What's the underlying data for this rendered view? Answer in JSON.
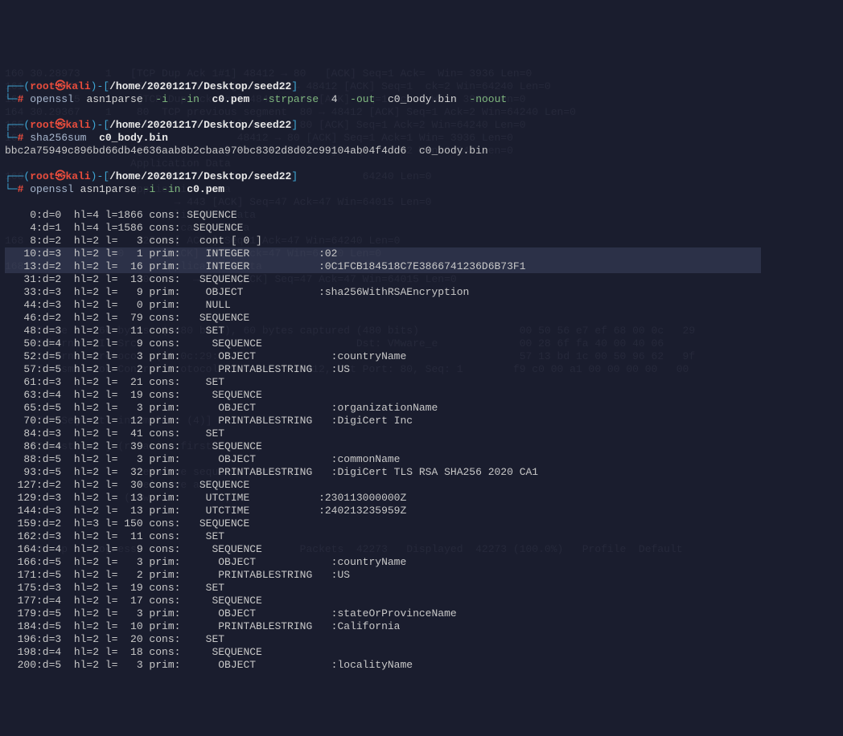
{
  "prompts": [
    {
      "open": "┌──(",
      "user": "root",
      "glyph": "㉿",
      "host": "kali",
      "mid": ")-[",
      "path": "/home/20201217/Desktop/seed22",
      "close": "]",
      "hash": "└─#",
      "command_parts": [
        {
          "t": "openssl",
          "c": "cmd"
        },
        {
          "t": "  asn1parse  ",
          "c": "arg"
        },
        {
          "t": "-i",
          "c": "gr"
        },
        {
          "t": "  ",
          "c": "arg"
        },
        {
          "t": "-in",
          "c": "gr"
        },
        {
          "t": "  ",
          "c": "arg"
        },
        {
          "t": "c0.pem",
          "c": "wh"
        },
        {
          "t": "  ",
          "c": "arg"
        },
        {
          "t": "-strparse",
          "c": "gr"
        },
        {
          "t": "  4  ",
          "c": "arg"
        },
        {
          "t": "-out",
          "c": "gr"
        },
        {
          "t": "  c0_body.bin  ",
          "c": "arg"
        },
        {
          "t": "-noout",
          "c": "gr"
        }
      ],
      "output": []
    },
    {
      "open": "┌──(",
      "user": "root",
      "glyph": "㉿",
      "host": "kali",
      "mid": ")-[",
      "path": "/home/20201217/Desktop/seed22",
      "close": "]",
      "hash": "└─#",
      "command_parts": [
        {
          "t": "sha256sum",
          "c": "cmd"
        },
        {
          "t": "  ",
          "c": "arg"
        },
        {
          "t": "c0_body.bin",
          "c": "wh"
        }
      ],
      "output": [
        "bbc2a75949c896bd66db4e636aab8b2cbaa970bc8302d8d02c99104ab04f4dd6  c0_body.bin"
      ]
    },
    {
      "open": "┌──(",
      "user": "root",
      "glyph": "㉿",
      "host": "kali",
      "mid": ")-[",
      "path": "/home/20201217/Desktop/seed22",
      "close": "]",
      "hash": "└─#",
      "command_parts": [
        {
          "t": "openssl",
          "c": "cmd"
        },
        {
          "t": " asn1parse ",
          "c": "arg"
        },
        {
          "t": "-i -in",
          "c": "gr"
        },
        {
          "t": " ",
          "c": "arg"
        },
        {
          "t": "c0.pem",
          "c": "wh"
        }
      ],
      "output": []
    }
  ],
  "asn1": [
    {
      "hl": false,
      "t": "    0:d=0  hl=4 l=1866 cons: SEQUENCE          "
    },
    {
      "hl": false,
      "t": "    4:d=1  hl=4 l=1586 cons:  SEQUENCE          "
    },
    {
      "hl": false,
      "t": "    8:d=2  hl=2 l=   3 cons:   cont [ 0 ]        "
    },
    {
      "hl": true,
      "t": "   10:d=3  hl=2 l=   1 prim:    INTEGER           :02"
    },
    {
      "hl": true,
      "t": "   13:d=2  hl=2 l=  16 prim:    INTEGER           :0C1FCB184518C7E3866741236D6B73F1"
    },
    {
      "hl": false,
      "t": "   31:d=2  hl=2 l=  13 cons:   SEQUENCE          "
    },
    {
      "hl": false,
      "t": "   33:d=3  hl=2 l=   9 prim:    OBJECT            :sha256WithRSAEncryption"
    },
    {
      "hl": false,
      "t": "   44:d=3  hl=2 l=   0 prim:    NULL              "
    },
    {
      "hl": false,
      "t": "   46:d=2  hl=2 l=  79 cons:   SEQUENCE          "
    },
    {
      "hl": false,
      "t": "   48:d=3  hl=2 l=  11 cons:    SET               "
    },
    {
      "hl": false,
      "t": "   50:d=4  hl=2 l=   9 cons:     SEQUENCE          "
    },
    {
      "hl": false,
      "t": "   52:d=5  hl=2 l=   3 prim:      OBJECT            :countryName"
    },
    {
      "hl": false,
      "t": "   57:d=5  hl=2 l=   2 prim:      PRINTABLESTRING   :US"
    },
    {
      "hl": false,
      "t": "   61:d=3  hl=2 l=  21 cons:    SET               "
    },
    {
      "hl": false,
      "t": "   63:d=4  hl=2 l=  19 cons:     SEQUENCE          "
    },
    {
      "hl": false,
      "t": "   65:d=5  hl=2 l=   3 prim:      OBJECT            :organizationName"
    },
    {
      "hl": false,
      "t": "   70:d=5  hl=2 l=  12 prim:      PRINTABLESTRING   :DigiCert Inc"
    },
    {
      "hl": false,
      "t": "   84:d=3  hl=2 l=  41 cons:    SET               "
    },
    {
      "hl": false,
      "t": "   86:d=4  hl=2 l=  39 cons:     SEQUENCE          "
    },
    {
      "hl": false,
      "t": "   88:d=5  hl=2 l=   3 prim:      OBJECT            :commonName"
    },
    {
      "hl": false,
      "t": "   93:d=5  hl=2 l=  32 prim:      PRINTABLESTRING   :DigiCert TLS RSA SHA256 2020 CA1"
    },
    {
      "hl": false,
      "t": "  127:d=2  hl=2 l=  30 cons:   SEQUENCE          "
    },
    {
      "hl": false,
      "t": "  129:d=3  hl=2 l=  13 prim:    UTCTIME           :230113000000Z"
    },
    {
      "hl": false,
      "t": "  144:d=3  hl=2 l=  13 prim:    UTCTIME           :240213235959Z"
    },
    {
      "hl": false,
      "t": "  159:d=2  hl=3 l= 150 cons:   SEQUENCE          "
    },
    {
      "hl": false,
      "t": "  162:d=3  hl=2 l=  11 cons:    SET               "
    },
    {
      "hl": false,
      "t": "  164:d=4  hl=2 l=   9 cons:     SEQUENCE          "
    },
    {
      "hl": false,
      "t": "  166:d=5  hl=2 l=   3 prim:      OBJECT            :countryName"
    },
    {
      "hl": false,
      "t": "  171:d=5  hl=2 l=   2 prim:      PRINTABLESTRING   :US"
    },
    {
      "hl": false,
      "t": "  175:d=3  hl=2 l=  19 cons:    SET               "
    },
    {
      "hl": false,
      "t": "  177:d=4  hl=2 l=  17 cons:     SEQUENCE          "
    },
    {
      "hl": false,
      "t": "  179:d=5  hl=2 l=   3 prim:      OBJECT            :stateOrProvinceName"
    },
    {
      "hl": false,
      "t": "  184:d=5  hl=2 l=  10 prim:      PRINTABLESTRING   :California"
    },
    {
      "hl": false,
      "t": "  196:d=3  hl=2 l=  20 cons:    SET               "
    },
    {
      "hl": false,
      "t": "  198:d=4  hl=2 l=  18 cons:     SEQUENCE          "
    },
    {
      "hl": false,
      "t": "  200:d=5  hl=2 l=   3 prim:      OBJECT            :localityName"
    }
  ],
  "ghost": [
    "                                                                                                    ",
    "                                                                                                    ",
    "                                                                                                    ",
    "                                                                                                    ",
    "                                                                                                    ",
    "160 30.28973    1   [TCP Dup Ack 1#1] 48412 → 80   [ACK] Seq=1 Ack=  Win= 3936 Len=0",
    "161 30.28975    1    TCP Previous segment  80 → 48412 [ACK] Seq=1  ck=2 Win=64240 Len=0",
    "162 30.28975    1    [TCP Dup Ack 1#1] 48424 → 80 [ACK] Seq=1 Ack=1 Win= 3936 Len=0               ",
    "164 30.29367    1    80  TCP previous segment  80 → 48412 [ACK] Seq=1 Ack=2 Win=64240 Len=0 ",
    "165 30.29368    1    [TCP Dup Ack 2#1] 48424 → 80 [ACK] Seq=1 Ack=2 Win=64240 Len=0               ",
    "166 30.29368    1                    48412 → 80 [ACK] Seq=1 Ack=1 Win= 3936 Len=0",
    "167 30.29368    1    [TCP retrans  ] 80 → 48412 [ACK] Seq=2 Ack=2 Win=64240 Len=0",
    "                    Application Data",
    "168  31  72     1       47060                            64240 Len=0",
    "                    Application Data",
    "                           → 443 [ACK] Seq=47 Ack=47 Win=64015 Len=0",
    "                        Application Data",
    "                    10      cation Data",
    "168                  42748 [ ACK ] Seq=1 Ack=47 Win=64240 Len=0",
    "                 10       [ACK] Seq=1 Ack=47 Win=64240 Len=0",
    "168                      Application Data",
    "                     60       →  443 [ACK] Seq=47 Ack=47 Win=64015 Len=0",
    "",
    " ",
    "",
    "     Frame 1:  60 bytes  ( 480 bits), 60 bytes captured (480 bits)                00 50 56 e7 ef 68 00 0c   29",
    "     Ethernet II  Src:                                  Dst: VMware_e             00 28 6f fa 40 00 40 06   ",
    "     Internet Protocol  (00:0c:29:                                                57 13 bd 1c 00 50 96 62   9f",
    "     Transmission Control Protocol  Src Port: 48412, Dst Port: 80, Seq: 1        f9 c0 00 a1 00 00 00 00   00",
    "",
    "",
    "",
    "    [TCP Segment  incomplete (4)]",
    "",
    "    [Timestamps ] (relative first frame )",
    "",
    "                     relative sequence number)]",
    "                     relative ack         ",
    "                   (raw          32)",
    "",
    "",
    "",
    "    c0   p   Progress                          Packets  42273   Displayed  42273 (100.0%)   Profile  Default"
  ]
}
